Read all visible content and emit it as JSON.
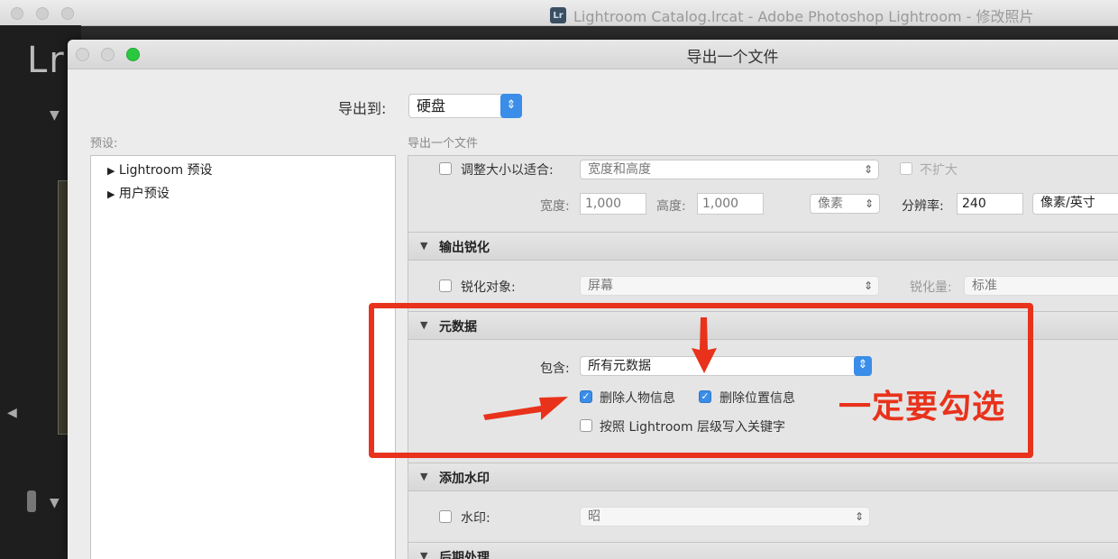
{
  "main_window": {
    "title": "Lightroom Catalog.lrcat - Adobe Photoshop Lightroom - 修改照片",
    "app_logo": "Lr",
    "icon": "lightroom-icon"
  },
  "dialog": {
    "title": "导出一个文件",
    "export_to_label": "导出到:",
    "export_to_value": "硬盘",
    "presets_label": "预设:",
    "export_label": "导出一个文件",
    "presets": [
      {
        "label": "Lightroom 预设"
      },
      {
        "label": "用户预设"
      }
    ],
    "resize": {
      "checkbox_label": "调整大小以适合:",
      "fit_value": "宽度和高度",
      "no_enlarge_label": "不扩大",
      "width_label": "宽度:",
      "width_value": "1,000",
      "height_label": "高度:",
      "height_value": "1,000",
      "unit_value": "像素",
      "resolution_label": "分辨率:",
      "resolution_value": "240",
      "resolution_unit": "像素/英寸"
    },
    "sharpening": {
      "title": "输出锐化",
      "checkbox_label": "锐化对象:",
      "target_value": "屏幕",
      "amount_label": "锐化量:",
      "amount_value": "标准"
    },
    "metadata": {
      "title": "元数据",
      "include_label": "包含:",
      "include_value": "所有元数据",
      "remove_person_label": "删除人物信息",
      "remove_person_checked": true,
      "remove_location_label": "删除位置信息",
      "remove_location_checked": true,
      "hierarchy_label": "按照 Lightroom 层级写入关键字",
      "hierarchy_checked": false
    },
    "watermark": {
      "title": "添加水印",
      "checkbox_label": "水印:",
      "value": "昭"
    },
    "post_processing": {
      "title": "后期处理"
    }
  },
  "annotation": {
    "text": "一定要勾选",
    "color": "#e8321c"
  }
}
